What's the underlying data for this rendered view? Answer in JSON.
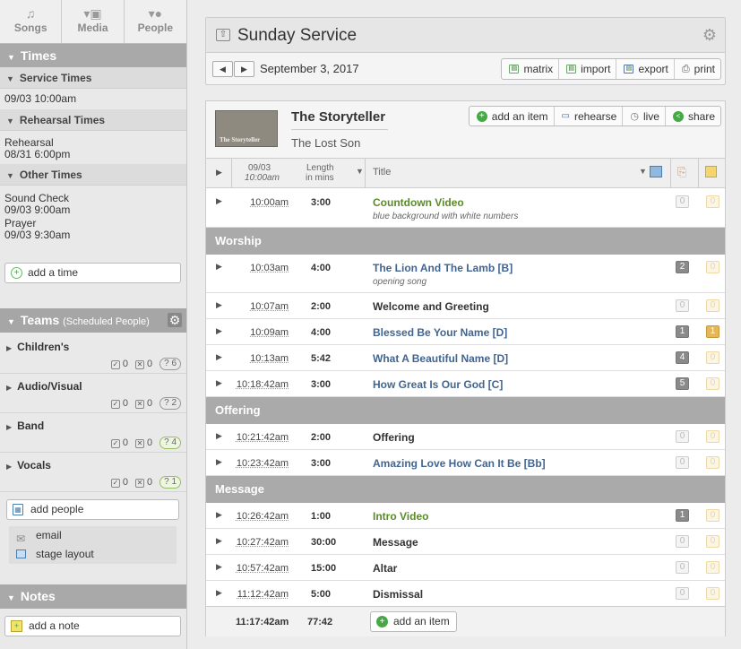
{
  "nav": {
    "songs": "Songs",
    "media": "Media",
    "people": "People"
  },
  "times": {
    "header": "Times",
    "service_header": "Service Times",
    "service_time": "09/03 10:00am",
    "rehearsal_header": "Rehearsal Times",
    "rehearsal_name": "Rehearsal",
    "rehearsal_time": "08/31 6:00pm",
    "other_header": "Other Times",
    "sound_name": "Sound Check",
    "sound_time": "09/03 9:00am",
    "prayer_name": "Prayer",
    "prayer_time": "09/03 9:30am",
    "add_time": "add a time"
  },
  "teams": {
    "header": "Teams",
    "sub": "(Scheduled People)",
    "list": [
      {
        "name": "Children's",
        "accepted": "0",
        "declined": "0",
        "pending": "6"
      },
      {
        "name": "Audio/Visual",
        "accepted": "0",
        "declined": "0",
        "pending": "2"
      },
      {
        "name": "Band",
        "accepted": "0",
        "declined": "0",
        "pending": "4"
      },
      {
        "name": "Vocals",
        "accepted": "0",
        "declined": "0",
        "pending": "1"
      }
    ],
    "add_people": "add people",
    "email": "email",
    "stage_layout": "stage layout"
  },
  "notes": {
    "header": "Notes",
    "add_note": "add a note"
  },
  "plan": {
    "title": "Sunday Service",
    "date": "September 3, 2017",
    "buttons": {
      "matrix": "matrix",
      "import": "import",
      "export": "export",
      "print": "print"
    }
  },
  "series": {
    "title": "The Storyteller",
    "subtitle": "The Lost Son",
    "thumb_text": "The Storyteller",
    "buttons": {
      "add": "add an item",
      "rehearse": "rehearse",
      "live": "live",
      "share": "share"
    }
  },
  "columns": {
    "date": "09/03",
    "time": "10:00am",
    "length": "Length",
    "length2": "in mins",
    "title": "Title"
  },
  "items": [
    {
      "time": "10:00am",
      "length": "3:00",
      "title": "Countdown Video",
      "note": "blue background with white numbers",
      "kind": "media",
      "b1": "0",
      "b2": "0"
    },
    {
      "header": "Worship"
    },
    {
      "time": "10:03am",
      "length": "4:00",
      "title": "The Lion And The Lamb [B]",
      "note": "opening song",
      "kind": "song",
      "b1": "2",
      "b2": "0"
    },
    {
      "time": "10:07am",
      "length": "2:00",
      "title": "Welcome and Greeting",
      "kind": "item",
      "b1": "0",
      "b2": "0"
    },
    {
      "time": "10:09am",
      "length": "4:00",
      "title": "Blessed Be Your Name [D]",
      "kind": "song",
      "b1": "1",
      "b2": "1"
    },
    {
      "time": "10:13am",
      "length": "5:42",
      "title": "What A Beautiful Name [D]",
      "kind": "song",
      "b1": "4",
      "b2": "0"
    },
    {
      "time": "10:18:42am",
      "length": "3:00",
      "title": "How Great Is Our God [C]",
      "kind": "song",
      "b1": "5",
      "b2": "0"
    },
    {
      "header": "Offering"
    },
    {
      "time": "10:21:42am",
      "length": "2:00",
      "title": "Offering",
      "kind": "item",
      "b1": "0",
      "b2": "0"
    },
    {
      "time": "10:23:42am",
      "length": "3:00",
      "title": "Amazing Love How Can It Be [Bb]",
      "kind": "song",
      "b1": "0",
      "b2": "0"
    },
    {
      "header": "Message"
    },
    {
      "time": "10:26:42am",
      "length": "1:00",
      "title": "Intro Video",
      "kind": "media",
      "b1": "1",
      "b2": "0"
    },
    {
      "time": "10:27:42am",
      "length": "30:00",
      "title": "Message",
      "kind": "item",
      "b1": "0",
      "b2": "0"
    },
    {
      "time": "10:57:42am",
      "length": "15:00",
      "title": "Altar",
      "kind": "item",
      "b1": "0",
      "b2": "0"
    },
    {
      "time": "11:12:42am",
      "length": "5:00",
      "title": "Dismissal",
      "kind": "item",
      "b1": "0",
      "b2": "0"
    }
  ],
  "footer": {
    "end_time": "11:17:42am",
    "total": "77:42",
    "add": "add an item"
  }
}
